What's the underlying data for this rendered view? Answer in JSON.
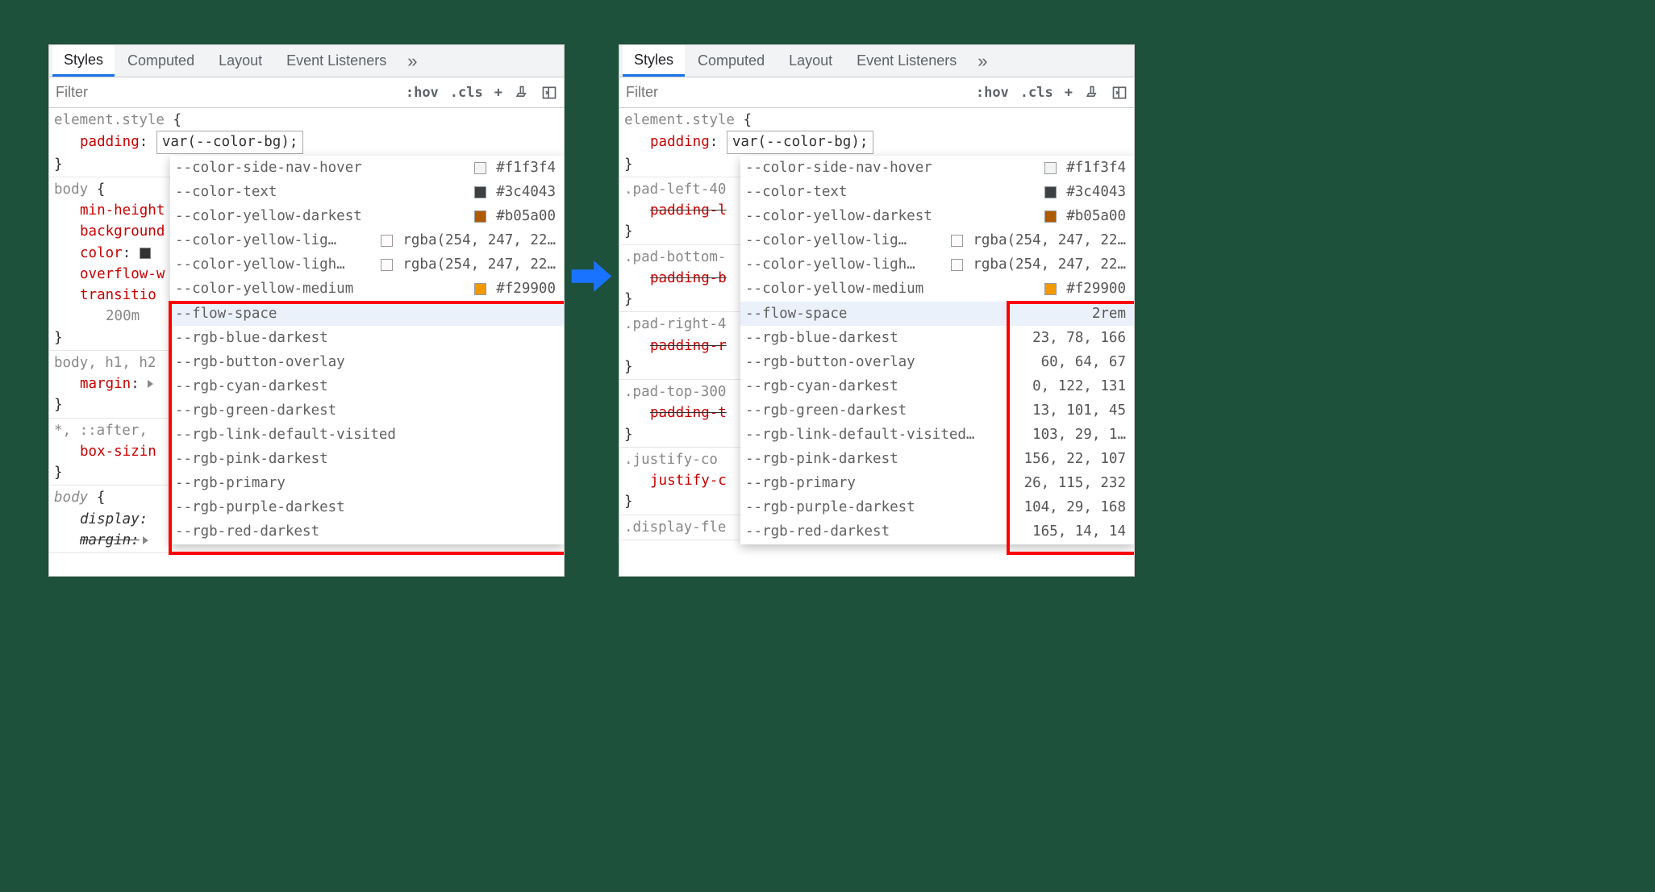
{
  "tabs": {
    "styles": "Styles",
    "computed": "Computed",
    "layout": "Layout",
    "events": "Event Listeners"
  },
  "toolbar": {
    "filter_placeholder": "Filter",
    "hov": ":hov",
    "cls": ".cls",
    "plus": "+"
  },
  "element_style": {
    "selector": "element.style",
    "prop": "padding",
    "val": "var(--color-bg);"
  },
  "body_rule": {
    "selector": "body",
    "min_height": "min-height",
    "background": "background",
    "color": "color",
    "overflow": "overflow-w",
    "transition": "transitio",
    "twohundred": "200m"
  },
  "body_h": {
    "selector": "body, h1, h2",
    "margin": "margin"
  },
  "star_rule": {
    "selector": "*, ::after,",
    "box": "box-sizin"
  },
  "body_last": {
    "selector": "body",
    "display": "display:",
    "margin": "margin:"
  },
  "pads": {
    "left": ".pad-left-40",
    "left_prop": "padding-l",
    "bottom": ".pad-bottom-",
    "bottom_prop": "padding-b",
    "right": ".pad-right-4",
    "right_prop": "padding-r",
    "top": ".pad-top-300",
    "top_prop": "padding-t",
    "justify": ".justify-co",
    "justify_prop": "justify-c",
    "display": ".display-fle"
  },
  "ac_colors": [
    {
      "name": "--color-side-nav-hover",
      "swatch": "#f1f3f4",
      "hex": "#f1f3f4"
    },
    {
      "name": "--color-text",
      "swatch": "#3c4043",
      "hex": "#3c4043"
    },
    {
      "name": "--color-yellow-darkest",
      "swatch": "#b05a00",
      "hex": "#b05a00"
    },
    {
      "name": "--color-yellow-lig…",
      "swatch": "#fefafa",
      "hex": "rgba(254, 247, 22…",
      "trunc": true
    },
    {
      "name": "--color-yellow-ligh…",
      "swatch": "#fefafa",
      "hex": "rgba(254, 247, 22…",
      "trunc": true
    },
    {
      "name": "--color-yellow-medium",
      "swatch": "#f29900",
      "hex": "#f29900"
    }
  ],
  "ac_vars_left": [
    "--flow-space",
    "--rgb-blue-darkest",
    "--rgb-button-overlay",
    "--rgb-cyan-darkest",
    "--rgb-green-darkest",
    "--rgb-link-default-visited",
    "--rgb-pink-darkest",
    "--rgb-primary",
    "--rgb-purple-darkest",
    "--rgb-red-darkest"
  ],
  "ac_vars_right": [
    {
      "name": "--flow-space",
      "val": "2rem"
    },
    {
      "name": "--rgb-blue-darkest",
      "val": "23, 78, 166"
    },
    {
      "name": "--rgb-button-overlay",
      "val": "60, 64, 67"
    },
    {
      "name": "--rgb-cyan-darkest",
      "val": "0, 122, 131"
    },
    {
      "name": "--rgb-green-darkest",
      "val": "13, 101, 45"
    },
    {
      "name": "--rgb-link-default-visited…",
      "val": "103, 29, 1…"
    },
    {
      "name": "--rgb-pink-darkest",
      "val": "156, 22, 107"
    },
    {
      "name": "--rgb-primary",
      "val": "26, 115, 232"
    },
    {
      "name": "--rgb-purple-darkest",
      "val": "104, 29, 168"
    },
    {
      "name": "--rgb-red-darkest",
      "val": "165, 14, 14"
    }
  ]
}
